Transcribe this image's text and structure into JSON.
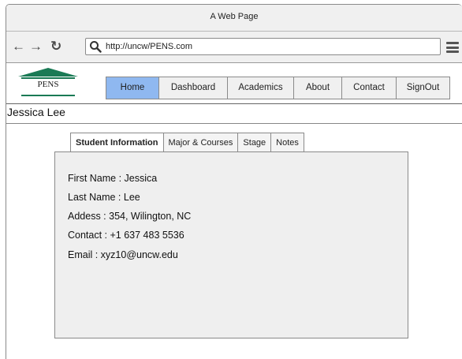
{
  "window": {
    "title": "A Web Page"
  },
  "browser": {
    "back_glyph": "←",
    "forward_glyph": "→",
    "reload_glyph": "↻",
    "url": "http://uncw/PENS.com"
  },
  "site": {
    "logo_text": "PENS",
    "nav": [
      {
        "label": "Home",
        "active": true
      },
      {
        "label": "Dashboard"
      },
      {
        "label": "Academics"
      },
      {
        "label": "About"
      },
      {
        "label": "Contact"
      },
      {
        "label": "SignOut"
      }
    ]
  },
  "user": {
    "name": "Jessica Lee"
  },
  "tabs": [
    {
      "label": "Student Information",
      "active": true
    },
    {
      "label": "Major & Courses"
    },
    {
      "label": "Stage"
    },
    {
      "label": "Notes"
    }
  ],
  "student_info": {
    "first_name": "First Name : Jessica",
    "last_name": "Last Name : Lee",
    "address": "Addess : 354, Wilington, NC",
    "contact": "Contact : +1 637 483 5536",
    "email": "Email : xyz10@uncw.edu"
  },
  "colors": {
    "active_nav": "#8fb8f0",
    "panel_bg": "#efefef",
    "chrome_bg": "#f0f0f0"
  }
}
